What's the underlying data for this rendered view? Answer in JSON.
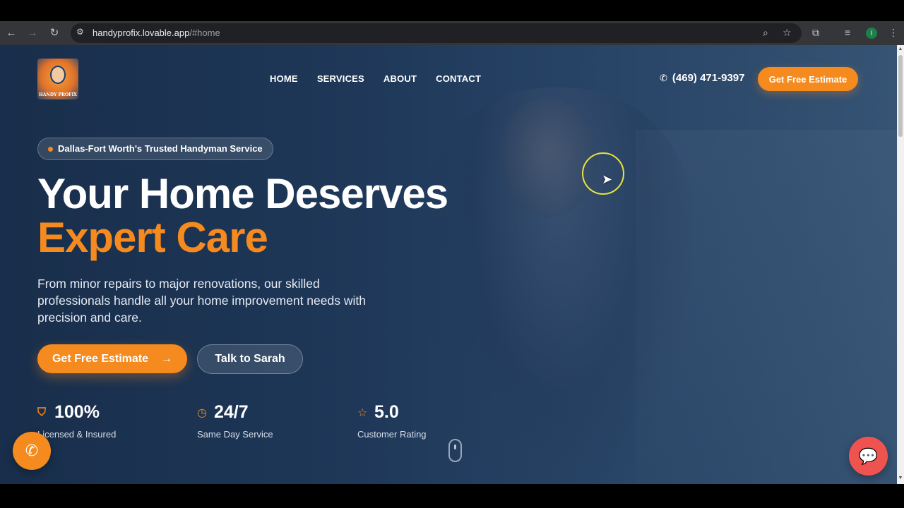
{
  "browser": {
    "url_host": "handyprofix.lovable.app",
    "url_path": "/#home",
    "profile_initial": "I"
  },
  "site": {
    "logo_text": "HANDY PROFIX",
    "nav": [
      "HOME",
      "SERVICES",
      "ABOUT",
      "CONTACT"
    ],
    "phone": "(469) 471-9397",
    "cta_top": "Get Free Estimate"
  },
  "hero": {
    "badge": "Dallas-Fort Worth's Trusted Handyman Service",
    "headline_line1": "Your Home Deserves",
    "headline_line2": "Expert Care",
    "subtext": "From minor repairs to major renovations, our skilled professionals handle all your home improvement needs with precision and care.",
    "btn_primary": "Get Free Estimate",
    "btn_secondary": "Talk to Sarah",
    "stats": [
      {
        "icon": "shield-icon",
        "value": "100%",
        "label": "Licensed & Insured"
      },
      {
        "icon": "clock-icon",
        "value": "24/7",
        "label": "Same Day Service"
      },
      {
        "icon": "star-icon",
        "value": "5.0",
        "label": "Customer Rating"
      }
    ]
  },
  "colors": {
    "accent": "#f58a1f",
    "chat": "#ef5350",
    "hero_bg": "#243f5f"
  }
}
